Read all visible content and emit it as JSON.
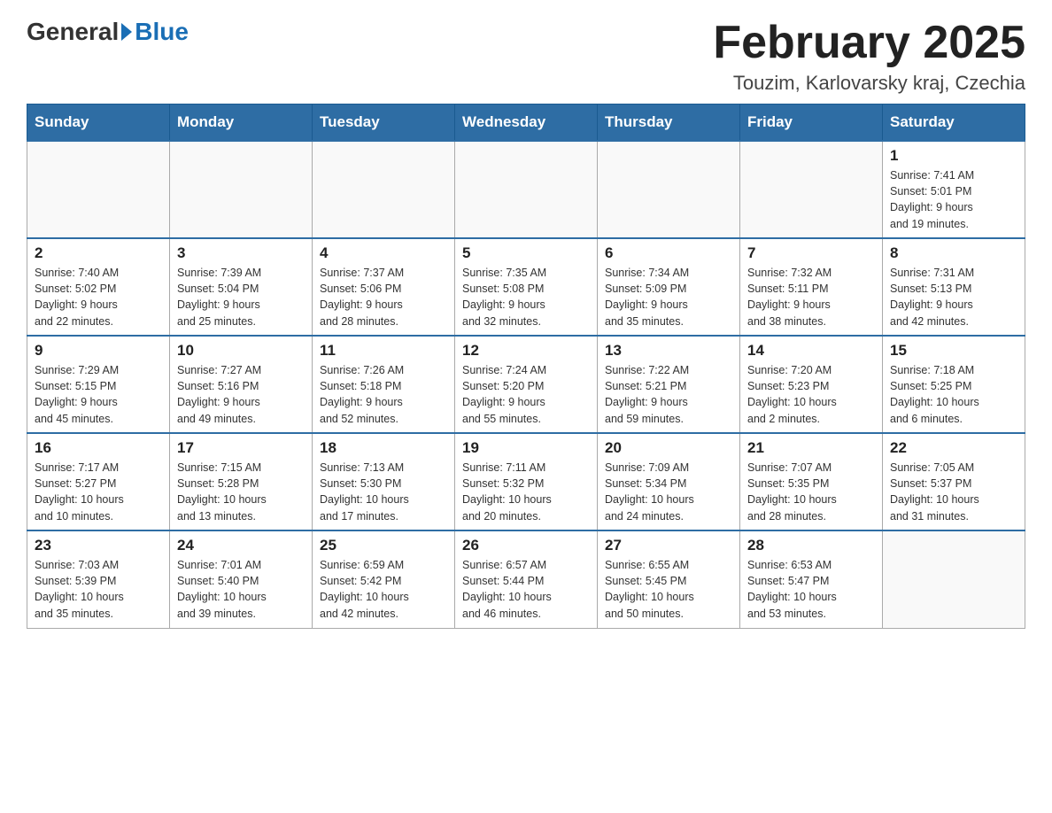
{
  "header": {
    "logo": {
      "part1": "General",
      "part2": "Blue"
    },
    "title": "February 2025",
    "subtitle": "Touzim, Karlovarsky kraj, Czechia"
  },
  "days_of_week": [
    "Sunday",
    "Monday",
    "Tuesday",
    "Wednesday",
    "Thursday",
    "Friday",
    "Saturday"
  ],
  "weeks": [
    [
      {
        "day": "",
        "info": ""
      },
      {
        "day": "",
        "info": ""
      },
      {
        "day": "",
        "info": ""
      },
      {
        "day": "",
        "info": ""
      },
      {
        "day": "",
        "info": ""
      },
      {
        "day": "",
        "info": ""
      },
      {
        "day": "1",
        "info": "Sunrise: 7:41 AM\nSunset: 5:01 PM\nDaylight: 9 hours\nand 19 minutes."
      }
    ],
    [
      {
        "day": "2",
        "info": "Sunrise: 7:40 AM\nSunset: 5:02 PM\nDaylight: 9 hours\nand 22 minutes."
      },
      {
        "day": "3",
        "info": "Sunrise: 7:39 AM\nSunset: 5:04 PM\nDaylight: 9 hours\nand 25 minutes."
      },
      {
        "day": "4",
        "info": "Sunrise: 7:37 AM\nSunset: 5:06 PM\nDaylight: 9 hours\nand 28 minutes."
      },
      {
        "day": "5",
        "info": "Sunrise: 7:35 AM\nSunset: 5:08 PM\nDaylight: 9 hours\nand 32 minutes."
      },
      {
        "day": "6",
        "info": "Sunrise: 7:34 AM\nSunset: 5:09 PM\nDaylight: 9 hours\nand 35 minutes."
      },
      {
        "day": "7",
        "info": "Sunrise: 7:32 AM\nSunset: 5:11 PM\nDaylight: 9 hours\nand 38 minutes."
      },
      {
        "day": "8",
        "info": "Sunrise: 7:31 AM\nSunset: 5:13 PM\nDaylight: 9 hours\nand 42 minutes."
      }
    ],
    [
      {
        "day": "9",
        "info": "Sunrise: 7:29 AM\nSunset: 5:15 PM\nDaylight: 9 hours\nand 45 minutes."
      },
      {
        "day": "10",
        "info": "Sunrise: 7:27 AM\nSunset: 5:16 PM\nDaylight: 9 hours\nand 49 minutes."
      },
      {
        "day": "11",
        "info": "Sunrise: 7:26 AM\nSunset: 5:18 PM\nDaylight: 9 hours\nand 52 minutes."
      },
      {
        "day": "12",
        "info": "Sunrise: 7:24 AM\nSunset: 5:20 PM\nDaylight: 9 hours\nand 55 minutes."
      },
      {
        "day": "13",
        "info": "Sunrise: 7:22 AM\nSunset: 5:21 PM\nDaylight: 9 hours\nand 59 minutes."
      },
      {
        "day": "14",
        "info": "Sunrise: 7:20 AM\nSunset: 5:23 PM\nDaylight: 10 hours\nand 2 minutes."
      },
      {
        "day": "15",
        "info": "Sunrise: 7:18 AM\nSunset: 5:25 PM\nDaylight: 10 hours\nand 6 minutes."
      }
    ],
    [
      {
        "day": "16",
        "info": "Sunrise: 7:17 AM\nSunset: 5:27 PM\nDaylight: 10 hours\nand 10 minutes."
      },
      {
        "day": "17",
        "info": "Sunrise: 7:15 AM\nSunset: 5:28 PM\nDaylight: 10 hours\nand 13 minutes."
      },
      {
        "day": "18",
        "info": "Sunrise: 7:13 AM\nSunset: 5:30 PM\nDaylight: 10 hours\nand 17 minutes."
      },
      {
        "day": "19",
        "info": "Sunrise: 7:11 AM\nSunset: 5:32 PM\nDaylight: 10 hours\nand 20 minutes."
      },
      {
        "day": "20",
        "info": "Sunrise: 7:09 AM\nSunset: 5:34 PM\nDaylight: 10 hours\nand 24 minutes."
      },
      {
        "day": "21",
        "info": "Sunrise: 7:07 AM\nSunset: 5:35 PM\nDaylight: 10 hours\nand 28 minutes."
      },
      {
        "day": "22",
        "info": "Sunrise: 7:05 AM\nSunset: 5:37 PM\nDaylight: 10 hours\nand 31 minutes."
      }
    ],
    [
      {
        "day": "23",
        "info": "Sunrise: 7:03 AM\nSunset: 5:39 PM\nDaylight: 10 hours\nand 35 minutes."
      },
      {
        "day": "24",
        "info": "Sunrise: 7:01 AM\nSunset: 5:40 PM\nDaylight: 10 hours\nand 39 minutes."
      },
      {
        "day": "25",
        "info": "Sunrise: 6:59 AM\nSunset: 5:42 PM\nDaylight: 10 hours\nand 42 minutes."
      },
      {
        "day": "26",
        "info": "Sunrise: 6:57 AM\nSunset: 5:44 PM\nDaylight: 10 hours\nand 46 minutes."
      },
      {
        "day": "27",
        "info": "Sunrise: 6:55 AM\nSunset: 5:45 PM\nDaylight: 10 hours\nand 50 minutes."
      },
      {
        "day": "28",
        "info": "Sunrise: 6:53 AM\nSunset: 5:47 PM\nDaylight: 10 hours\nand 53 minutes."
      },
      {
        "day": "",
        "info": ""
      }
    ]
  ]
}
